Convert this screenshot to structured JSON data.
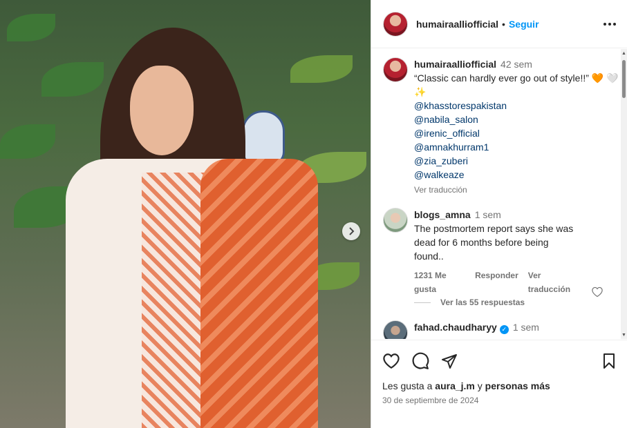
{
  "post": {
    "author": "humairaalliofficial",
    "follow_label": "Seguir",
    "separator": "•"
  },
  "caption": {
    "username": "humairaalliofficial",
    "time": "42 sem",
    "text": "“Classic can hardly ever go out of style!!”",
    "emojis": [
      "🧡",
      "🤍",
      "✨"
    ],
    "mentions": [
      "@khasstorespakistan",
      "@nabila_salon",
      "@irenic_official",
      "@amnakhurram1",
      "@zia_zuberi",
      "@walkeaze"
    ],
    "translate": "Ver traducción"
  },
  "comments": [
    {
      "username": "blogs_amna",
      "time": "1 sem",
      "text": "The postmortem report says she was dead for 6 months before being found..",
      "likes": "1231 Me gusta",
      "reply": "Responder",
      "translate": "Ver traducción",
      "replies": "Ver las 55 respuestas"
    },
    {
      "username": "fahad.chaudharyy",
      "time": "1 sem",
      "verified": true
    }
  ],
  "footer": {
    "likes_prefix": "Les gusta a",
    "likes_user": "aura_j.m",
    "likes_middle": "y",
    "likes_rest": "personas más",
    "date": "30 de septiembre de 2024"
  },
  "icons": {
    "like": "heart-icon",
    "comment": "comment-icon",
    "share": "share-icon",
    "save": "bookmark-icon",
    "more": "more-icon",
    "next": "chevron-right-icon"
  }
}
